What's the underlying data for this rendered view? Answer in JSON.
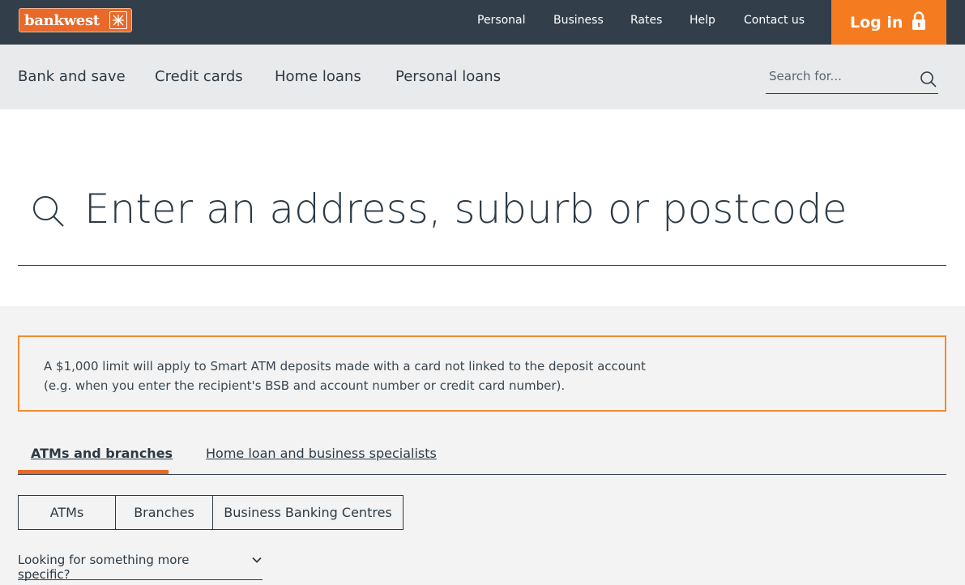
{
  "brand": {
    "name": "bankwest",
    "accent": "#f47b20",
    "dark": "#323f4b"
  },
  "topnav": {
    "items": [
      "Personal",
      "Business",
      "Rates",
      "Help",
      "Contact us"
    ],
    "login_label": "Log in",
    "login_icon": "lock-icon"
  },
  "subnav": {
    "items": [
      "Bank and save",
      "Credit cards",
      "Home loans",
      "Personal loans"
    ],
    "search_placeholder": "Search for..."
  },
  "locator": {
    "search_placeholder": "Enter an address, suburb or postcode"
  },
  "notice": {
    "line1": "A $1,000 limit will apply to Smart ATM deposits made with a card not linked to the deposit account",
    "line2": "(e.g. when you enter the recipient's BSB and account number or credit card number)."
  },
  "tabs": {
    "items": [
      "ATMs and branches",
      "Home loan and business specialists"
    ],
    "active": "ATMs and branches"
  },
  "filters": [
    "ATMs",
    "Branches",
    "Business Banking Centres"
  ],
  "more_specific": {
    "label": "Looking for something more specific?"
  }
}
